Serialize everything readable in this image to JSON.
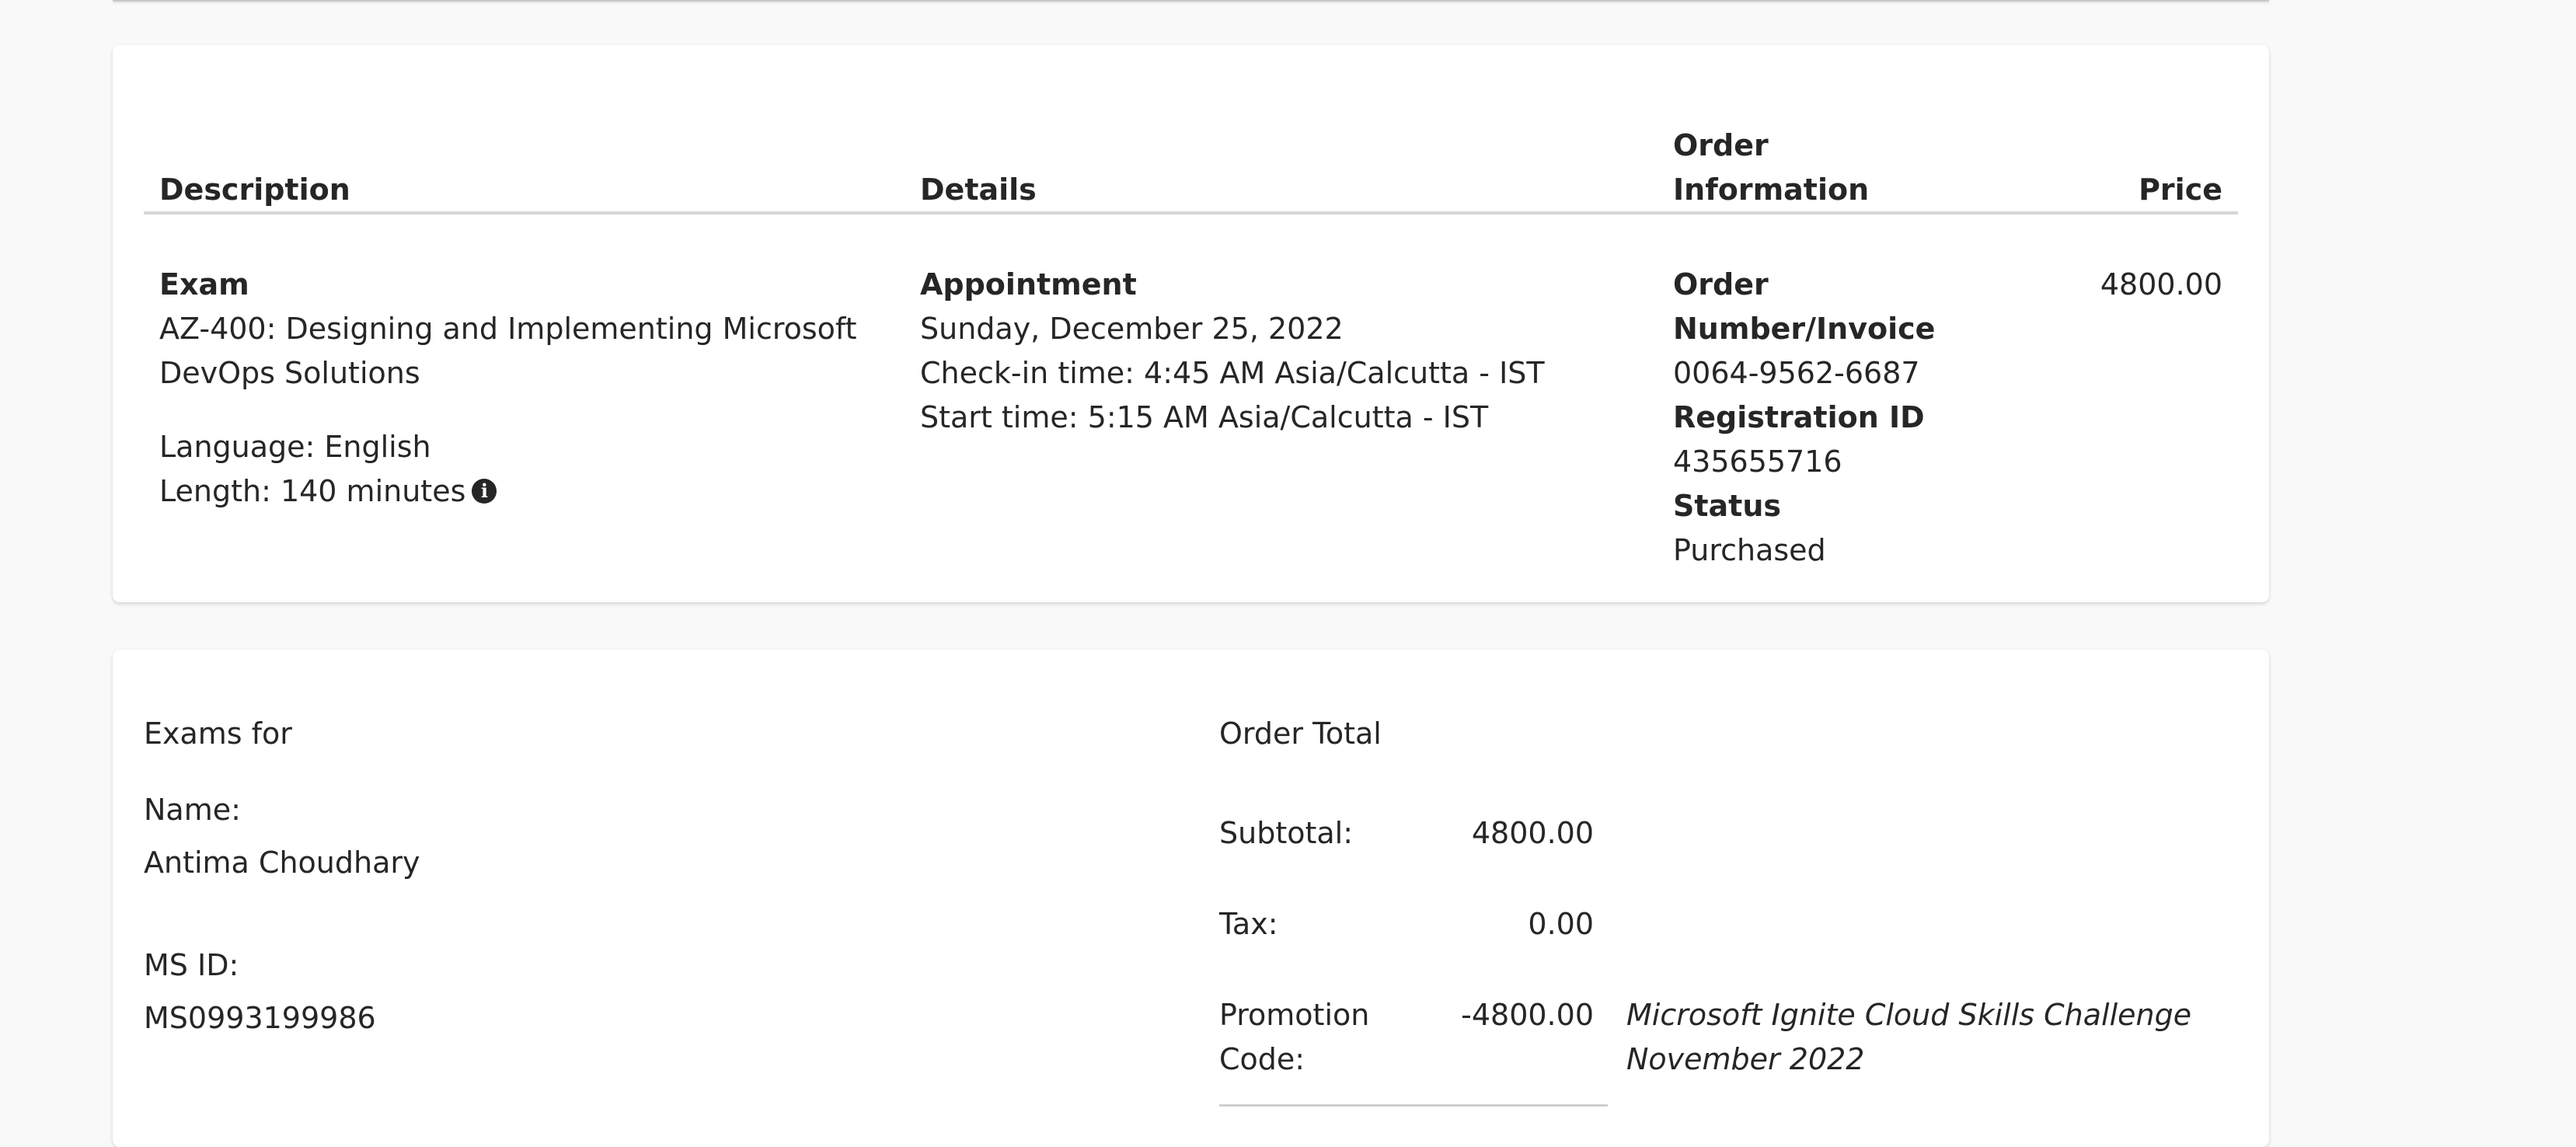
{
  "items_table": {
    "headers": {
      "description": "Description",
      "details": "Details",
      "order_information_line1": "Order",
      "order_information_line2": "Information",
      "price": "Price"
    },
    "row": {
      "description": {
        "type_label": "Exam",
        "exam_title_line1": "AZ-400: Designing and Implementing Microsoft",
        "exam_title_line2": "DevOps Solutions",
        "language": "Language: English",
        "length": "Length: 140 minutes",
        "info_icon": "info-circle-icon"
      },
      "details": {
        "heading": "Appointment",
        "date": "Sunday, December 25, 2022",
        "checkin": "Check-in time: 4:45 AM Asia/Calcutta - IST",
        "start": "Start time: 5:15 AM Asia/Calcutta - IST"
      },
      "order_information": {
        "order_number_label_line1": "Order",
        "order_number_label_line2": "Number/Invoice",
        "order_number": "0064-9562-6687",
        "registration_label": "Registration ID",
        "registration_id": "435655716",
        "status_label": "Status",
        "status": "Purchased"
      },
      "price": "4800.00"
    }
  },
  "summary": {
    "exams_for_label": "Exams for",
    "name_label": "Name:",
    "name_value": "Antima Choudhary",
    "msid_label": "MS ID:",
    "msid_value": "MS0993199986",
    "order_total_label": "Order Total",
    "subtotal_label": "Subtotal:",
    "subtotal_value": "4800.00",
    "tax_label": "Tax:",
    "tax_value": "0.00",
    "promo_label_line1": "Promotion",
    "promo_label_line2": "Code:",
    "promo_value": "-4800.00",
    "promo_name_line1": "Microsoft Ignite Cloud Skills Challenge",
    "promo_name_line2": "November 2022"
  }
}
